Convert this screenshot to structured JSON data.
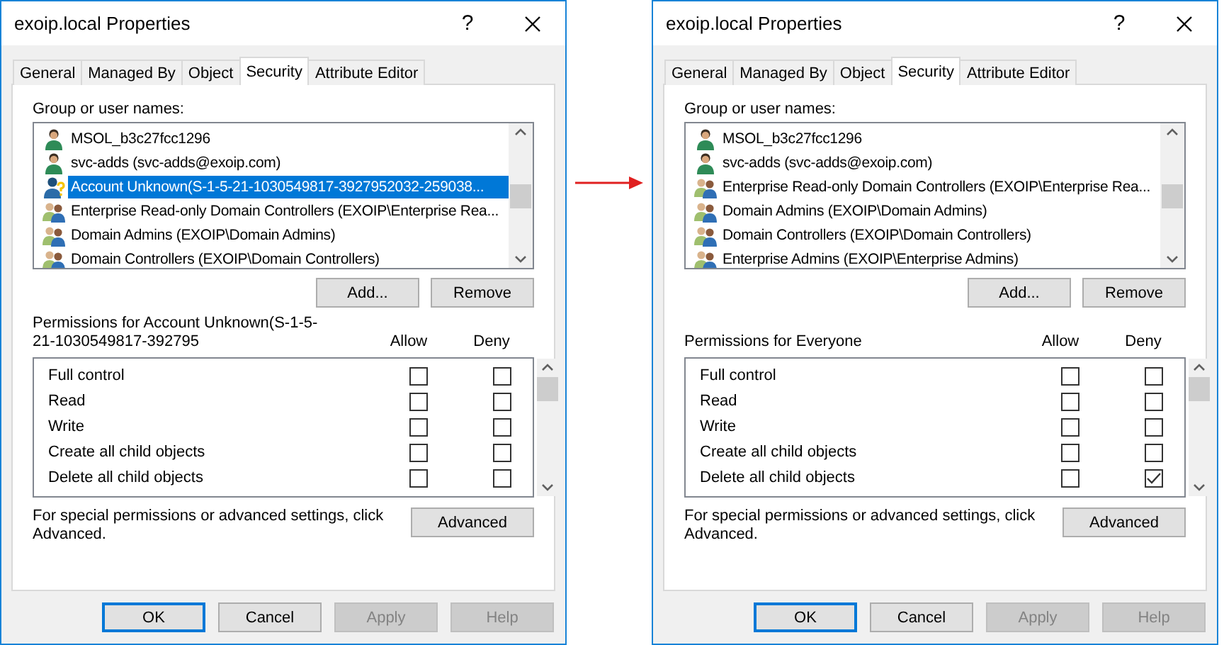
{
  "dialogs": [
    {
      "title": "exoip.local Properties",
      "help_button": "?",
      "tabs": [
        {
          "label": "General",
          "selected": false
        },
        {
          "label": "Managed By",
          "selected": false
        },
        {
          "label": "Object",
          "selected": false
        },
        {
          "label": "Security",
          "selected": true
        },
        {
          "label": "Attribute Editor",
          "selected": false
        }
      ],
      "group_label": "Group or user names:",
      "principals": [
        {
          "name": "MSOL_b3c27fcc1296",
          "kind": "user",
          "selected": false
        },
        {
          "name": "svc-adds (svc-adds@exoip.com)",
          "kind": "user",
          "selected": false
        },
        {
          "name": "Account Unknown(S-1-5-21-1030549817-3927952032-259038...",
          "kind": "unknown",
          "selected": true
        },
        {
          "name": "Enterprise Read-only Domain Controllers (EXOIP\\Enterprise Rea...",
          "kind": "group",
          "selected": false
        },
        {
          "name": "Domain Admins (EXOIP\\Domain Admins)",
          "kind": "group",
          "selected": false
        },
        {
          "name": "Domain Controllers (EXOIP\\Domain Controllers)",
          "kind": "group",
          "selected": false
        }
      ],
      "list_buttons": [
        "Add...",
        "Remove"
      ],
      "permissions_label": "Permissions for Account Unknown(S-1-5-21-1030549817-392795",
      "allow_label": "Allow",
      "deny_label": "Deny",
      "permissions": [
        {
          "name": "Full control",
          "allow": false,
          "deny": false
        },
        {
          "name": "Read",
          "allow": false,
          "deny": false
        },
        {
          "name": "Write",
          "allow": false,
          "deny": false
        },
        {
          "name": "Create all child objects",
          "allow": false,
          "deny": false
        },
        {
          "name": "Delete all child objects",
          "allow": false,
          "deny": false
        }
      ],
      "note": "For special permissions or advanced settings, click Advanced.",
      "advanced_button": "Advanced",
      "footer_buttons": [
        {
          "label": "OK",
          "default": true,
          "disabled": false
        },
        {
          "label": "Cancel",
          "default": false,
          "disabled": false
        },
        {
          "label": "Apply",
          "default": false,
          "disabled": true
        },
        {
          "label": "Help",
          "default": false,
          "disabled": true
        }
      ]
    },
    {
      "title": "exoip.local Properties",
      "help_button": "?",
      "tabs": [
        {
          "label": "General",
          "selected": false
        },
        {
          "label": "Managed By",
          "selected": false
        },
        {
          "label": "Object",
          "selected": false
        },
        {
          "label": "Security",
          "selected": true
        },
        {
          "label": "Attribute Editor",
          "selected": false
        }
      ],
      "group_label": "Group or user names:",
      "principals": [
        {
          "name": "MSOL_b3c27fcc1296",
          "kind": "user",
          "selected": false
        },
        {
          "name": "svc-adds (svc-adds@exoip.com)",
          "kind": "user",
          "selected": false
        },
        {
          "name": "Enterprise Read-only Domain Controllers (EXOIP\\Enterprise Rea...",
          "kind": "group",
          "selected": false
        },
        {
          "name": "Domain Admins (EXOIP\\Domain Admins)",
          "kind": "group",
          "selected": false
        },
        {
          "name": "Domain Controllers (EXOIP\\Domain Controllers)",
          "kind": "group",
          "selected": false
        },
        {
          "name": "Enterprise Admins (EXOIP\\Enterprise Admins)",
          "kind": "group",
          "selected": false
        }
      ],
      "list_buttons": [
        "Add...",
        "Remove"
      ],
      "permissions_label": "Permissions for Everyone",
      "allow_label": "Allow",
      "deny_label": "Deny",
      "permissions": [
        {
          "name": "Full control",
          "allow": false,
          "deny": false
        },
        {
          "name": "Read",
          "allow": false,
          "deny": false
        },
        {
          "name": "Write",
          "allow": false,
          "deny": false
        },
        {
          "name": "Create all child objects",
          "allow": false,
          "deny": false
        },
        {
          "name": "Delete all child objects",
          "allow": false,
          "deny": true
        }
      ],
      "note": "For special permissions or advanced settings, click Advanced.",
      "advanced_button": "Advanced",
      "footer_buttons": [
        {
          "label": "OK",
          "default": true,
          "disabled": false
        },
        {
          "label": "Cancel",
          "default": false,
          "disabled": false
        },
        {
          "label": "Apply",
          "default": false,
          "disabled": true
        },
        {
          "label": "Help",
          "default": false,
          "disabled": true
        }
      ]
    }
  ]
}
